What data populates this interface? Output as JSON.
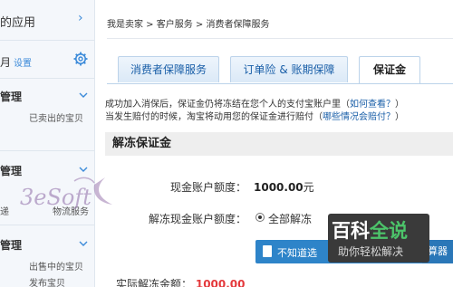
{
  "sidebar": {
    "top_label": "的应用",
    "top_arrow": "›",
    "sub_label": "月",
    "settings_link": "设置",
    "groups": [
      {
        "title": "管理",
        "items": [
          "已卖出的宝贝"
        ]
      },
      {
        "title": "管理",
        "items": [
          "物流服务",
          "递"
        ]
      },
      {
        "title": "管理",
        "items": [
          "出售中的宝贝",
          "发布宝贝"
        ]
      }
    ]
  },
  "breadcrumb": {
    "seller": "我是卖家",
    "sep": " > ",
    "service": "客户服务",
    "current": "消费者保障服务"
  },
  "tabs": [
    {
      "label": "消费者保障服务",
      "active": false
    },
    {
      "label": "订单险 & 账期保障",
      "active": false
    },
    {
      "label": "保证金",
      "active": true
    }
  ],
  "notice": {
    "line1_text": "成功加入消保后，保证金仍将冻结在您个人的支付宝账户里（",
    "line1_link": "如何查看？",
    "line1_end": "）",
    "line2_text": "当发生赔付的时候，淘宝将动用您的保证金进行赔付（",
    "line2_link": "哪些情况会赔付？",
    "line2_end": "）"
  },
  "unfreeze": {
    "title": "解冻保证金",
    "cash_label": "现金账户额度：",
    "cash_value": "1000.00",
    "cash_unit": "元",
    "amount_label": "解冻现金账户额度：",
    "option_all": "全部解冻"
  },
  "tip_bar": {
    "text": "不知道选",
    "right_text": "算器"
  },
  "bottom_row": {
    "label": "实际解冻金额：",
    "value": "1000.00"
  },
  "watermark": {
    "baike_title_1": "百科",
    "baike_title_2": "全说",
    "baike_sub": "助你轻松解决",
    "logo_text": "3eSoft"
  },
  "colors": {
    "link": "#1a5fa8",
    "tab_text": "#1a5fa8",
    "tip_bar": "#2e84c9",
    "amount": "#e4393c",
    "sidebar_bg": "#f4f7fb"
  }
}
